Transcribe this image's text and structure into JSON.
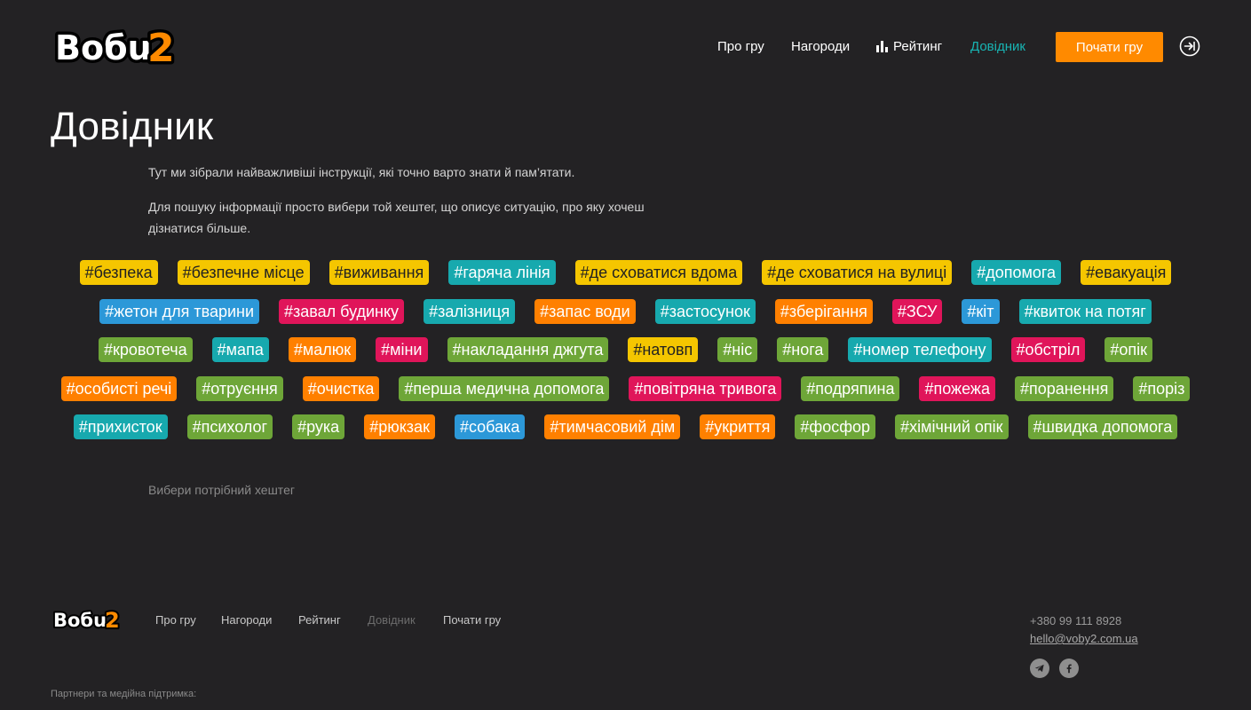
{
  "brand": {
    "logo_text": "Вобu2"
  },
  "nav": {
    "items": [
      "Про гру",
      "Нагороди",
      "Рейтинг",
      "Довідник"
    ],
    "active": "Довідник",
    "start_button": "Почати гру",
    "login_icon": "sign-in-icon",
    "rating_icon": "bar-chart-icon"
  },
  "page": {
    "title": "Довідник",
    "intro_1": "Тут ми зібрали найважливіші інструкції, які точно варто знати й пам’ятати.",
    "intro_2": "Для пошуку інформації просто вибери той хештег, що описує ситуацію, про яку хочеш дізнатися більше.",
    "hint": "Вибери потрібний хештег"
  },
  "colors": {
    "yellow": "#f5c600",
    "teal": "#17a9ae",
    "blue": "#2c98d8",
    "pink": "#e0155a",
    "orange": "#ff8000",
    "green": "#6ea638",
    "accent": "#18b4b3",
    "background": "#232224"
  },
  "tag_rows": [
    [
      {
        "label": "#безпека",
        "color": "yellow"
      },
      {
        "label": "#безпечне місце",
        "color": "yellow"
      },
      {
        "label": "#виживання",
        "color": "yellow"
      },
      {
        "label": "#гаряча лінія",
        "color": "teal"
      },
      {
        "label": "#де сховатися вдома",
        "color": "yellow"
      },
      {
        "label": "#де сховатися на вулиці",
        "color": "yellow"
      },
      {
        "label": "#допомога",
        "color": "teal"
      },
      {
        "label": "#евакуація",
        "color": "yellow"
      }
    ],
    [
      {
        "label": "#жетон для тварини",
        "color": "blue"
      },
      {
        "label": "#завал будинку",
        "color": "pink"
      },
      {
        "label": "#залізниця",
        "color": "teal"
      },
      {
        "label": "#запас води",
        "color": "orange"
      },
      {
        "label": "#застосунок",
        "color": "teal"
      },
      {
        "label": "#зберігання",
        "color": "orange"
      },
      {
        "label": "#ЗСУ",
        "color": "pink"
      },
      {
        "label": "#кіт",
        "color": "blue"
      },
      {
        "label": "#квиток на потяг",
        "color": "teal"
      }
    ],
    [
      {
        "label": "#кровотеча",
        "color": "green"
      },
      {
        "label": "#мапа",
        "color": "teal"
      },
      {
        "label": "#малюк",
        "color": "orange"
      },
      {
        "label": "#міни",
        "color": "pink"
      },
      {
        "label": "#накладання джгута",
        "color": "green"
      },
      {
        "label": "#натовп",
        "color": "yellow"
      },
      {
        "label": "#ніс",
        "color": "green"
      },
      {
        "label": "#нога",
        "color": "green"
      },
      {
        "label": "#номер телефону",
        "color": "teal"
      },
      {
        "label": "#обстріл",
        "color": "pink"
      },
      {
        "label": "#опік",
        "color": "green"
      }
    ],
    [
      {
        "label": "#особисті речі",
        "color": "orange"
      },
      {
        "label": "#отруєння",
        "color": "green"
      },
      {
        "label": "#очистка",
        "color": "orange"
      },
      {
        "label": "#перша медична допомога",
        "color": "green"
      },
      {
        "label": "#повітряна тривога",
        "color": "pink"
      },
      {
        "label": "#подряпина",
        "color": "green"
      },
      {
        "label": "#пожежа",
        "color": "pink"
      },
      {
        "label": "#поранення",
        "color": "green"
      },
      {
        "label": "#поріз",
        "color": "green"
      }
    ],
    [
      {
        "label": "#прихисток",
        "color": "teal"
      },
      {
        "label": "#психолог",
        "color": "green"
      },
      {
        "label": "#рука",
        "color": "green"
      },
      {
        "label": "#рюкзак",
        "color": "orange"
      },
      {
        "label": "#собака",
        "color": "blue"
      },
      {
        "label": "#тимчасовий дім",
        "color": "orange"
      },
      {
        "label": "#укриття",
        "color": "orange"
      },
      {
        "label": "#фосфор",
        "color": "green"
      },
      {
        "label": "#хімічний опік",
        "color": "green"
      },
      {
        "label": "#швидка допомога",
        "color": "green"
      }
    ]
  ],
  "footer": {
    "nav": [
      "Про гру",
      "Нагороди",
      "Рейтинг",
      "Довідник",
      "Почати гру"
    ],
    "dim_item": "Довідник",
    "phone": "+380 99 111 8928",
    "email": "hello@voby2.com.ua",
    "social_icons": [
      "telegram-icon",
      "facebook-icon"
    ],
    "partners": "Партнери та медійна підтримка:"
  }
}
